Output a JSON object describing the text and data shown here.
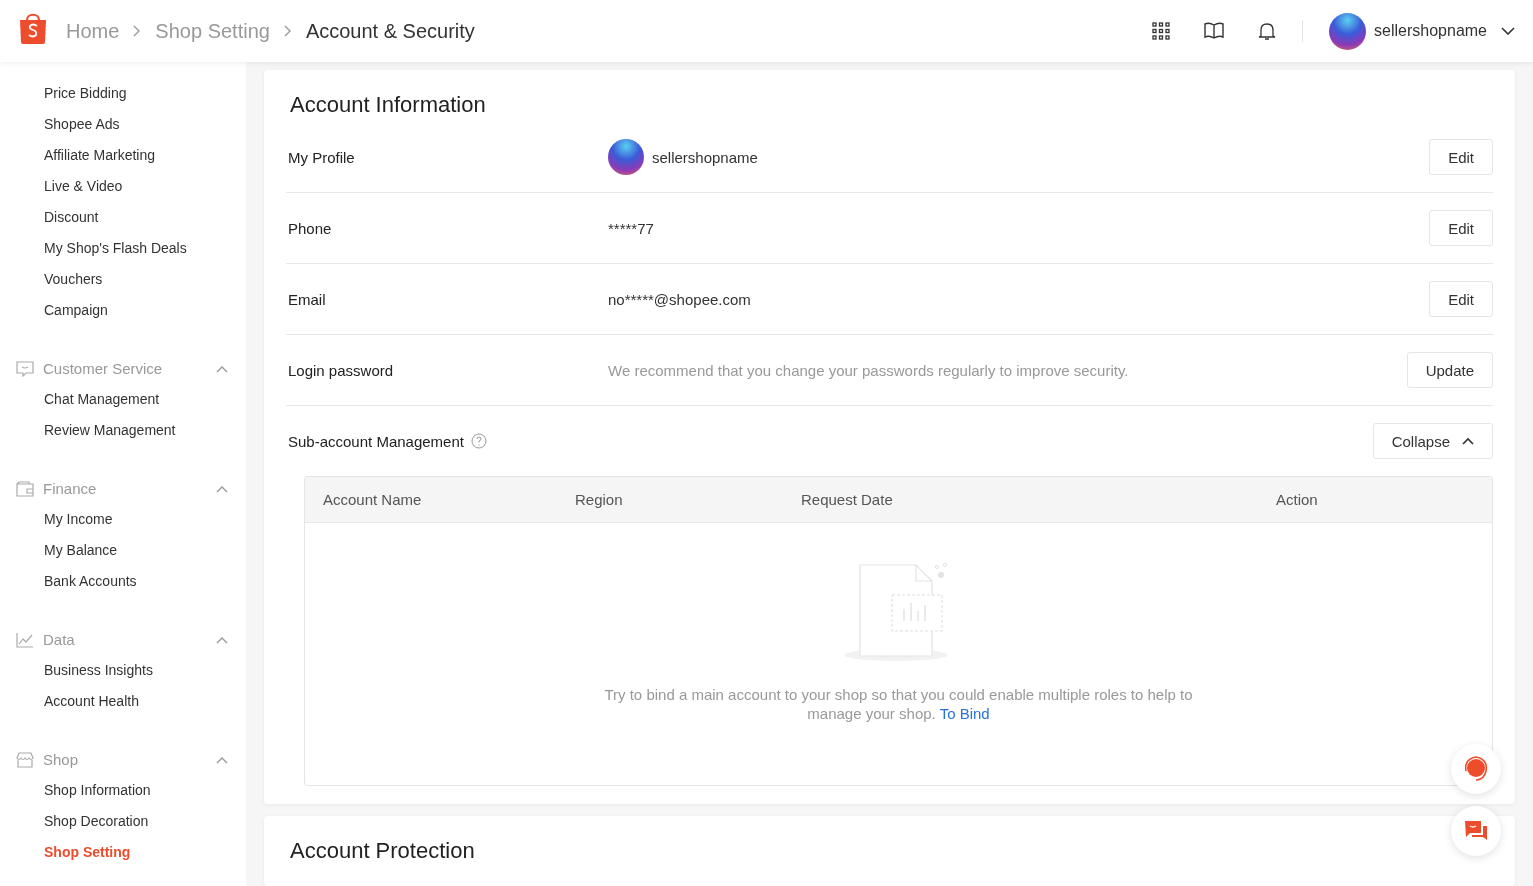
{
  "header": {
    "breadcrumb": [
      {
        "label": "Home",
        "current": false
      },
      {
        "label": "Shop Setting",
        "current": false
      },
      {
        "label": "Account & Security",
        "current": true
      }
    ],
    "username": "sellershopname"
  },
  "sidebar": {
    "top_items": [
      {
        "label": "Price Bidding",
        "selected": false
      },
      {
        "label": "Shopee Ads",
        "selected": false
      },
      {
        "label": "Affiliate Marketing",
        "selected": false
      },
      {
        "label": "Live & Video",
        "selected": false
      },
      {
        "label": "Discount",
        "selected": false
      },
      {
        "label": "My Shop's Flash Deals",
        "selected": false
      },
      {
        "label": "Vouchers",
        "selected": false
      },
      {
        "label": "Campaign",
        "selected": false
      }
    ],
    "sections": [
      {
        "title": "Customer Service",
        "kind": "chat",
        "expanded": true,
        "items": [
          {
            "label": "Chat Management",
            "selected": false
          },
          {
            "label": "Review Management",
            "selected": false
          }
        ]
      },
      {
        "title": "Finance",
        "kind": "wallet",
        "expanded": true,
        "items": [
          {
            "label": "My Income",
            "selected": false
          },
          {
            "label": "My Balance",
            "selected": false
          },
          {
            "label": "Bank Accounts",
            "selected": false
          }
        ]
      },
      {
        "title": "Data",
        "kind": "chart",
        "expanded": true,
        "items": [
          {
            "label": "Business Insights",
            "selected": false
          },
          {
            "label": "Account Health",
            "selected": false
          }
        ]
      },
      {
        "title": "Shop",
        "kind": "shop",
        "expanded": true,
        "items": [
          {
            "label": "Shop Information",
            "selected": false
          },
          {
            "label": "Shop Decoration",
            "selected": false
          },
          {
            "label": "Shop Setting",
            "selected": true
          }
        ]
      }
    ]
  },
  "account_information": {
    "title": "Account Information",
    "rows": [
      {
        "kind": "profile",
        "label": "My Profile",
        "value": "sellershopname",
        "button": "Edit"
      },
      {
        "kind": "text",
        "label": "Phone",
        "value": "*****77",
        "button": "Edit"
      },
      {
        "kind": "text",
        "label": "Email",
        "value": "no*****@shopee.com",
        "button": "Edit"
      },
      {
        "kind": "hint",
        "label": "Login password",
        "value": "We recommend that you change your passwords regularly to improve security.",
        "button": "Update"
      }
    ],
    "sub_account": {
      "label": "Sub-account Management",
      "button": "Collapse",
      "expanded": true,
      "columns": [
        "Account Name",
        "Region",
        "Request Date",
        "Action"
      ],
      "empty_text": "Try to bind a main account to your shop so that you could enable multiple roles to help to manage your shop.",
      "link": "To Bind"
    }
  },
  "account_protection": {
    "title": "Account Protection"
  }
}
